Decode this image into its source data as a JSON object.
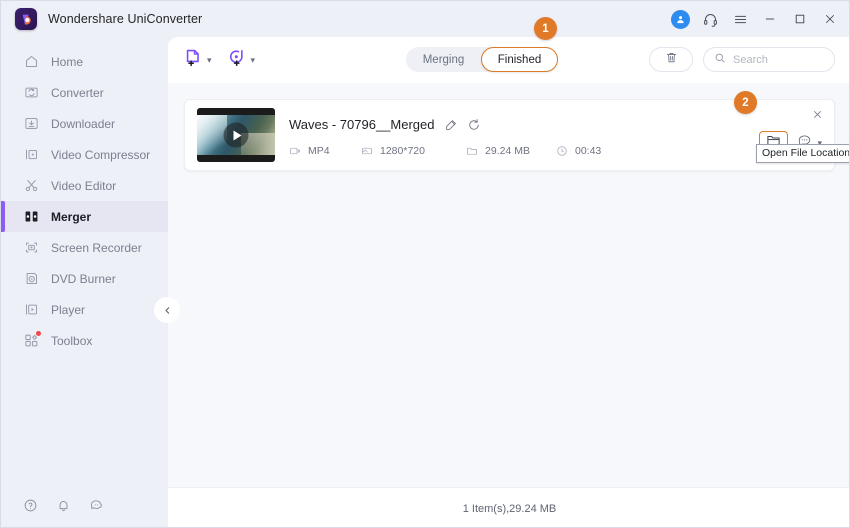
{
  "window": {
    "title": "Wondershare UniConverter",
    "controls": {
      "account": "account-avatar",
      "support": "headset-icon",
      "menu": "hamburger-menu",
      "minimize": "—",
      "maximize": "□",
      "close": "✕"
    }
  },
  "sidebar": {
    "items": [
      {
        "label": "Home",
        "icon": "home-icon",
        "active": false
      },
      {
        "label": "Converter",
        "icon": "converter-icon",
        "active": false
      },
      {
        "label": "Downloader",
        "icon": "download-icon",
        "active": false
      },
      {
        "label": "Video Compressor",
        "icon": "compressor-icon",
        "active": false
      },
      {
        "label": "Video Editor",
        "icon": "scissors-icon",
        "active": false
      },
      {
        "label": "Merger",
        "icon": "merger-icon",
        "active": true
      },
      {
        "label": "Screen Recorder",
        "icon": "screen-recorder-icon",
        "active": false
      },
      {
        "label": "DVD Burner",
        "icon": "disc-icon",
        "active": false
      },
      {
        "label": "Player",
        "icon": "player-icon",
        "active": false
      },
      {
        "label": "Toolbox",
        "icon": "toolbox-icon",
        "active": false
      }
    ],
    "bottom_icons": [
      "help-icon",
      "bell-icon",
      "feedback-icon"
    ],
    "collapse_icon": "chevron-left-icon"
  },
  "toolbar": {
    "add_files_icon": "add-file-icon",
    "add_files_caret": "chevron-down-icon",
    "add_dvd_icon": "add-disc-icon",
    "add_dvd_caret": "chevron-down-icon",
    "tabs": [
      {
        "label": "Merging",
        "active": false
      },
      {
        "label": "Finished",
        "active": true
      }
    ],
    "trash_icon": "trash-icon",
    "search": {
      "icon": "search-icon",
      "placeholder": "Search",
      "value": ""
    }
  },
  "file_card": {
    "thumbnail_icon": "play-icon",
    "name": "Waves - 70796__Merged",
    "rename_icon": "edit-icon",
    "reconvert_icon": "refresh-icon",
    "meta": [
      {
        "icon": "format-icon",
        "value": "MP4"
      },
      {
        "icon": "resolution-icon",
        "value": "1280*720"
      },
      {
        "icon": "folder-icon",
        "value": "29.24 MB"
      },
      {
        "icon": "clock-icon",
        "value": "00:43"
      }
    ],
    "close_icon": "close-icon",
    "open_location_icon": "folder-open-icon",
    "more_icon": "more-options-icon",
    "more_caret": "chevron-down-icon",
    "tooltip": "Open File Location"
  },
  "badges": [
    {
      "label": "1"
    },
    {
      "label": "2"
    }
  ],
  "status": {
    "text": "1 Item(s),29.24 MB"
  },
  "colors": {
    "accent_purple": "#8b5cf6",
    "highlight_orange": "#d97b28",
    "badge_orange": "#e07a28",
    "sidebar_bg": "#eef0f7",
    "content_bg": "#f7f8fb"
  }
}
